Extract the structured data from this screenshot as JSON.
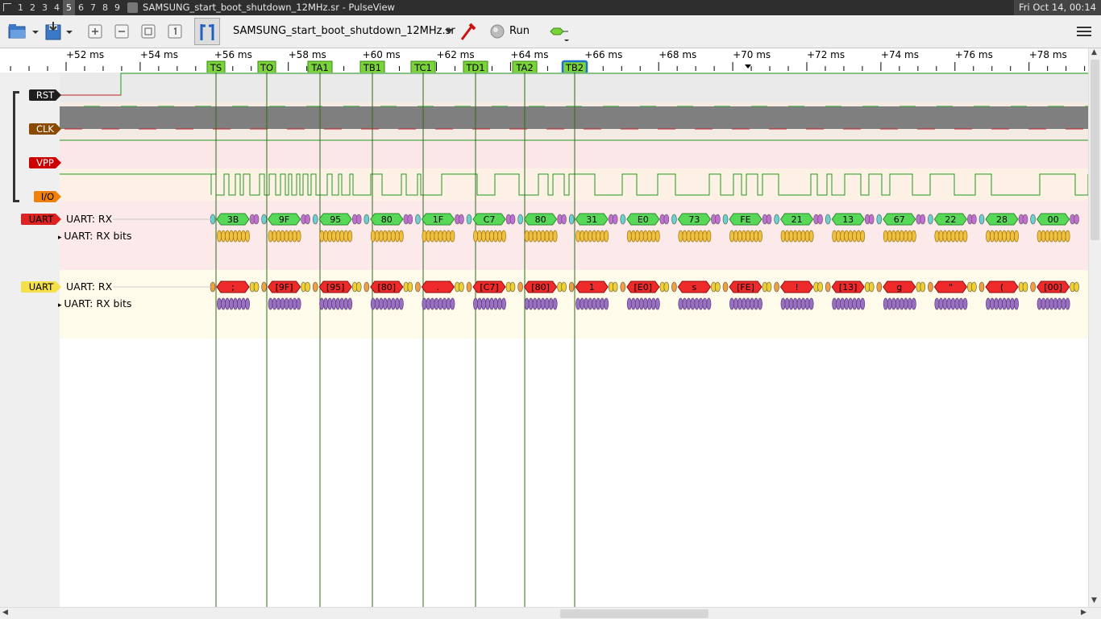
{
  "topbar": {
    "workspaces": [
      "1",
      "2",
      "3",
      "4",
      "5",
      "6",
      "7",
      "8",
      "9"
    ],
    "active_workspace": "5",
    "window_title": "SAMSUNG_start_boot_shutdown_12MHz.sr - PulseView",
    "clock": "Fri Oct 14, 00:14"
  },
  "toolbar": {
    "filename": "SAMSUNG_start_boot_shutdown_12MHz.sr",
    "run_label": "Run",
    "icons": [
      "open-icon",
      "save-icon",
      "zoom-in-icon",
      "zoom-out-icon",
      "zoom-fit-icon",
      "zoom-one-icon",
      "cursor-icon",
      "probe-icon",
      "decoder-icon",
      "menu-icon"
    ]
  },
  "ruler": {
    "ticks": [
      "+52 ms",
      "+54 ms",
      "+56 ms",
      "+58 ms",
      "+60 ms",
      "+62 ms",
      "+64 ms",
      "+66 ms",
      "+68 ms",
      "+70 ms",
      "+72 ms",
      "+74 ms",
      "+76 ms",
      "+78 ms"
    ],
    "markers": [
      "TS",
      "TO",
      "TA1",
      "TB1",
      "TC1",
      "TD1",
      "TA2",
      "TB2"
    ],
    "selected_marker": "TB2"
  },
  "signals": {
    "rst": "RST",
    "clk": "CLK",
    "vpp": "VPP",
    "io": "I/O"
  },
  "colors": {
    "rst": "#1e1e1e",
    "clk": "#8a4a00",
    "vpp": "#cc0000",
    "io": "#f0800a",
    "uart1": "#dd2222",
    "uart2": "#f4e04a",
    "annotation_green": "#58d858",
    "annotation_red": "#ee2a2a",
    "marker_green": "#7ad33a"
  },
  "decoder1": {
    "badge": "UART",
    "row_rx": "UART: RX",
    "row_bits": "UART: RX bits",
    "values": [
      "3B",
      "9F",
      "95",
      "80",
      "1F",
      "C7",
      "80",
      "31",
      "E0",
      "73",
      "FE",
      "21",
      "13",
      "67",
      "22",
      "28",
      "00"
    ]
  },
  "decoder2": {
    "badge": "UART",
    "row_rx": "UART: RX",
    "row_bits": "UART: RX bits",
    "values": [
      ";",
      "[9F]",
      "[95]",
      "[80]",
      ".",
      "[C7]",
      "[80]",
      "1",
      "[E0]",
      "s",
      "[FE]",
      "!",
      "[13]",
      "g",
      "\"",
      "(",
      "[00]"
    ]
  }
}
